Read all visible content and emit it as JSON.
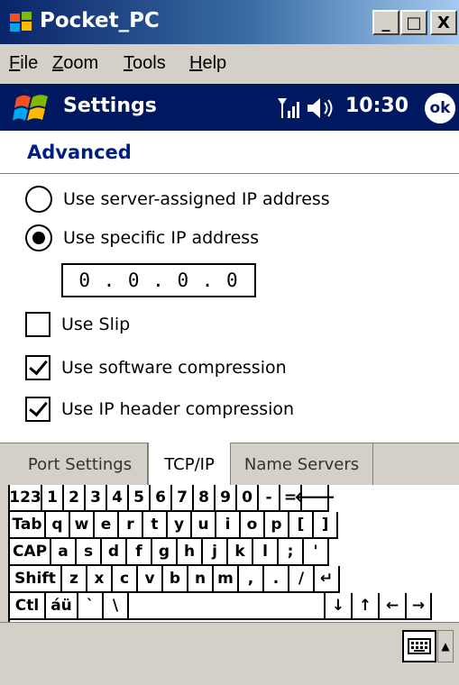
{
  "window": {
    "title": "Pocket_PC",
    "min_symbol": "_",
    "max_symbol": "□",
    "close_symbol": "X"
  },
  "menubar": [
    {
      "first": "F",
      "rest": "ile"
    },
    {
      "first": "Z",
      "rest": "oom"
    },
    {
      "first": "T",
      "rest": "ools"
    },
    {
      "first": "H",
      "rest": "elp"
    }
  ],
  "navbar": {
    "title": "Settings",
    "time": "10:30",
    "ok": "ok"
  },
  "content": {
    "header": "Advanced",
    "options": {
      "server_ip": "Use server-assigned IP address",
      "specific_ip": "Use specific IP address",
      "slip": "Use Slip",
      "software_compression": "Use software compression",
      "ip_header_compression": "Use IP header compression"
    },
    "ip_address": "0 . 0 . 0 . 0",
    "selected_ip_mode": "specific",
    "checks": {
      "slip": false,
      "software_compression": true,
      "ip_header_compression": true
    }
  },
  "tabs": [
    "Port Settings",
    "TCP/IP",
    "Name Servers"
  ],
  "active_tab": "TCP/IP",
  "keyboard": {
    "row1": [
      "123",
      "1",
      "2",
      "3",
      "4",
      "5",
      "6",
      "7",
      "8",
      "9",
      "0",
      "-",
      "=",
      "🡐"
    ],
    "row2": [
      "Tab",
      "q",
      "w",
      "e",
      "r",
      "t",
      "y",
      "u",
      "i",
      "o",
      "p",
      "[",
      "]"
    ],
    "row3": [
      "CAP",
      "a",
      "s",
      "d",
      "f",
      "g",
      "h",
      "j",
      "k",
      "l",
      ";",
      "'"
    ],
    "row4": [
      "Shift",
      "z",
      "x",
      "c",
      "v",
      "b",
      "n",
      "m",
      ",",
      ".",
      "/",
      "↵"
    ],
    "row5": [
      "Ctl",
      "áü",
      "`",
      "\\",
      "",
      "↓",
      "↑",
      "←",
      "→"
    ]
  },
  "colors": {
    "navbar": "#001860",
    "header_text": "#002080",
    "chrome": "#d4d0c8"
  }
}
